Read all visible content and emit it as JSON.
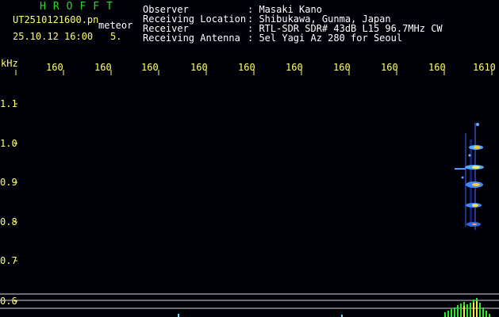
{
  "header": {
    "app_title": "HROFFT",
    "filename": "UT2510121600.pn",
    "mode": "meteor",
    "datetime": "25.10.12 16:00",
    "count": "5.",
    "fields": [
      {
        "label": "Observer",
        "value": ": Masaki Kano"
      },
      {
        "label": "Receiving Location",
        "value": ": Shibukawa, Gunma, Japan"
      },
      {
        "label": "Receiver",
        "value": ": RTL-SDR SDR# 43dB L15 96.7MHz CW"
      },
      {
        "label": "Receiving Antenna",
        "value": ": 5el Yagi Az 280 for Seoul"
      }
    ]
  },
  "axis": {
    "y_unit": "kHz",
    "x_ticks": [
      "160",
      "160",
      "160",
      "160",
      "160",
      "160",
      "160",
      "160",
      "160",
      "1610"
    ],
    "y_ticks": [
      "1.1",
      "1.0",
      "0.9",
      "0.8",
      "0.7",
      "0.6"
    ]
  },
  "colors": {
    "text_white": "#ffffff",
    "text_yellow": "#ffff66",
    "title_green": "#22dd22",
    "background": "#000008"
  }
}
